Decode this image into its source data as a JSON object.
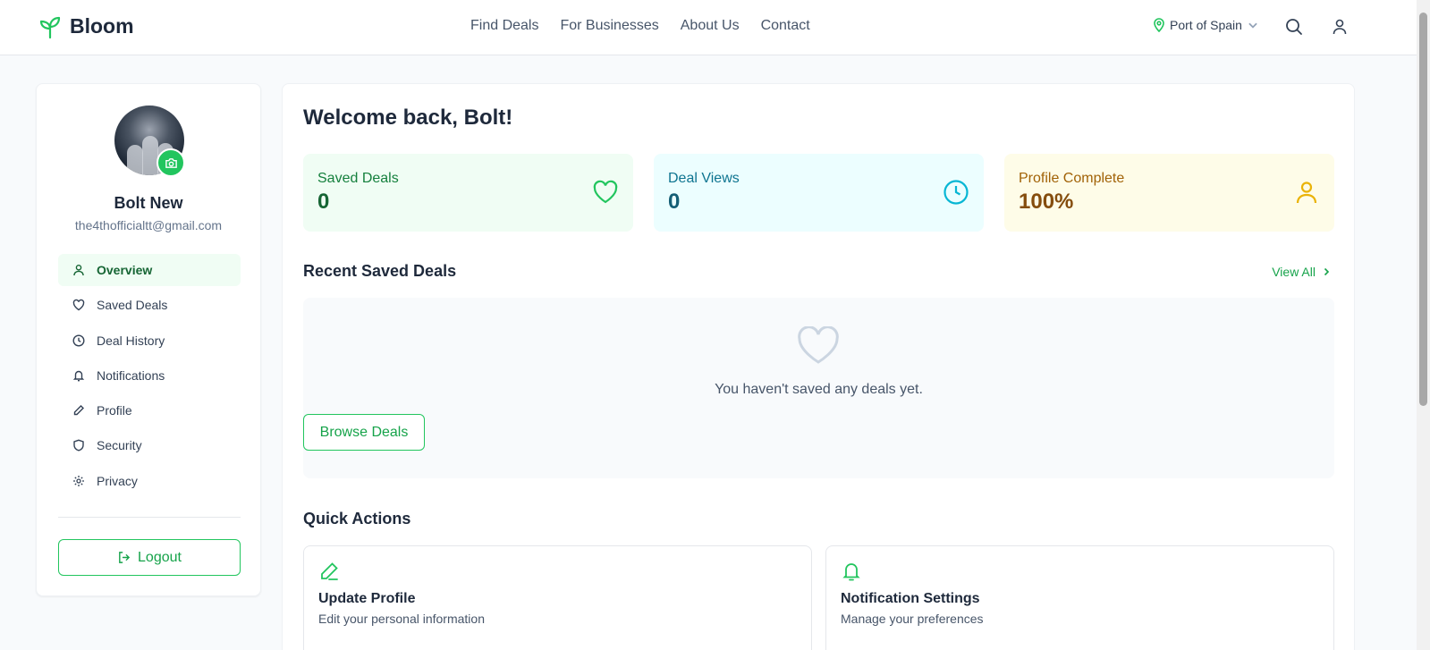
{
  "header": {
    "brand": "Bloom",
    "nav": [
      "Find Deals",
      "For Businesses",
      "About Us",
      "Contact"
    ],
    "location": "Port of Spain"
  },
  "profile": {
    "name": "Bolt New",
    "email": "the4thofficialtt@gmail.com"
  },
  "sidebar": {
    "items": [
      {
        "label": "Overview",
        "icon": "user-icon",
        "active": true
      },
      {
        "label": "Saved Deals",
        "icon": "heart-icon"
      },
      {
        "label": "Deal History",
        "icon": "clock-icon"
      },
      {
        "label": "Notifications",
        "icon": "bell-icon"
      },
      {
        "label": "Profile",
        "icon": "pencil-icon"
      },
      {
        "label": "Security",
        "icon": "shield-icon"
      },
      {
        "label": "Privacy",
        "icon": "gear-icon"
      }
    ],
    "logout_label": "Logout"
  },
  "main": {
    "welcome": "Welcome back, Bolt!",
    "stats": [
      {
        "label": "Saved Deals",
        "value": "0",
        "icon": "heart-icon",
        "color": "#22c55e"
      },
      {
        "label": "Deal Views",
        "value": "0",
        "icon": "clock-icon",
        "color": "#06b6d4"
      },
      {
        "label": "Profile Complete",
        "value": "100%",
        "icon": "user-icon",
        "color": "#eab308"
      }
    ],
    "recent_title": "Recent Saved Deals",
    "view_all": "View All",
    "empty_message": "You haven't saved any deals yet.",
    "browse_label": "Browse Deals",
    "quick_title": "Quick Actions",
    "quick_actions": [
      {
        "title": "Update Profile",
        "desc": "Edit your personal information",
        "icon": "pencil-icon"
      },
      {
        "title": "Notification Settings",
        "desc": "Manage your preferences",
        "icon": "bell-icon"
      }
    ]
  },
  "colors": {
    "accent": "#22c55e",
    "accent_dark": "#16a34a"
  }
}
